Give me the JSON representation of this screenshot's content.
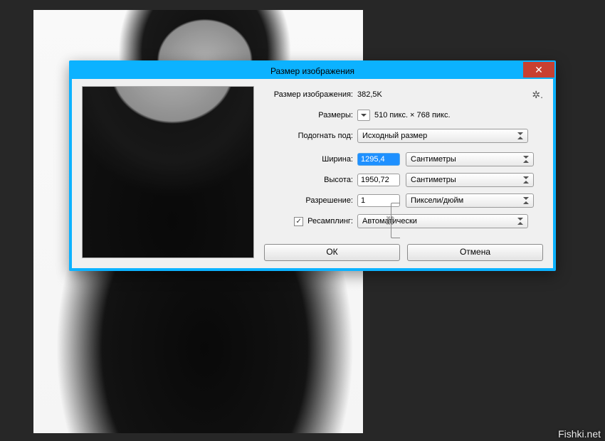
{
  "watermark": "Fishki.net",
  "dialog": {
    "title": "Размер изображения",
    "size_label": "Размер изображения:",
    "size_value": "382,5K",
    "dims_label": "Размеры:",
    "dims_value": "510 пикс.  ×  768 пикс.",
    "fit_label": "Подогнать под:",
    "fit_value": "Исходный размер",
    "width_label": "Ширина:",
    "width_value": "1295,4",
    "width_unit": "Сантиметры",
    "height_label": "Высота:",
    "height_value": "1950,72",
    "height_unit": "Сантиметры",
    "res_label": "Разрешение:",
    "res_value": "1",
    "res_unit": "Пиксели/дюйм",
    "resample_label": "Ресамплинг:",
    "resample_checked": true,
    "resample_value": "Автоматически",
    "ok": "ОК",
    "cancel": "Отмена"
  }
}
